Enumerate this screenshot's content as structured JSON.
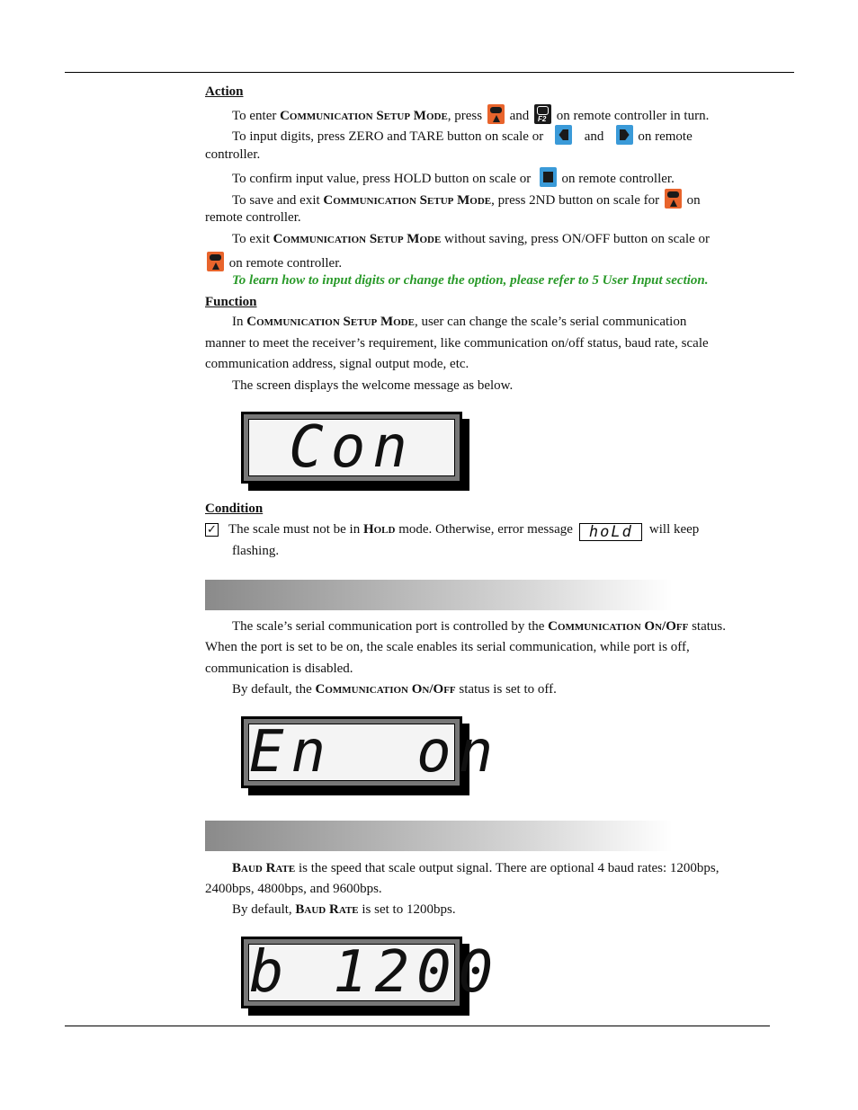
{
  "action": {
    "heading": "Action",
    "l1a": "To enter ",
    "mode": "Communication Setup Mode",
    "l1b": ", press",
    "and": "and",
    "l1c": "on remote controller in turn.",
    "l2a": "To input digits, press ZERO and TARE button on scale or",
    "l2c": "on remote",
    "l3": "controller.",
    "l4a": "To confirm input value, press HOLD button on scale or",
    "l4b": "on remote controller.",
    "l5a": "To save and exit ",
    "l5b": ", press 2ND button on scale for",
    "l5c": "on",
    "l6": "remote controller.",
    "l7a": "To exit ",
    "l7b": "without saving, press ON/OFF button on scale or",
    "l8": "on remote controller.",
    "note": "To learn how to input digits or change the option, please refer to 5 User Input section."
  },
  "function": {
    "heading": "Function",
    "l1a": "In ",
    "l1b": ", user can change the scale’s serial communication",
    "l2": "manner to meet the receiver’s requirement, like communication on/off status, baud rate, scale",
    "l3": "communication address, signal output mode, etc.",
    "l4": "The screen displays the welcome message as below.",
    "lcd": "Con"
  },
  "condition": {
    "heading": "Condition",
    "check": "☑",
    "l1a": "The scale must not be in ",
    "hold": "Hold",
    "l1b": " mode. Otherwise, error message",
    "err": "hoLd",
    "l1c": "will keep",
    "l2": "flashing."
  },
  "onoff": {
    "l1a": "The scale’s serial communication port is controlled by the ",
    "term": "Communication On/Off",
    "l1b": " status.",
    "l2": "When the port is set to be on, the scale enables its serial communication, while port is off,",
    "l3": "communication is disabled.",
    "l4a": "By default, the ",
    "l4b": " status is set to off.",
    "lcd": "En  on"
  },
  "baud": {
    "term": "Baud Rate",
    "l1": " is the speed that scale output signal. There are optional 4 baud rates: 1200bps,",
    "l2": "2400bps, 4800bps, and 9600bps.",
    "l3a": "By default, ",
    "l3b": " is set to 1200bps.",
    "lcd": "b 1200"
  },
  "icons": {
    "orange": "2nd-button-icon",
    "f2": "f2-button-icon",
    "left": "left-arrow-button-icon",
    "right": "right-arrow-button-icon",
    "square": "hold-button-icon",
    "power": "power-button-icon"
  }
}
